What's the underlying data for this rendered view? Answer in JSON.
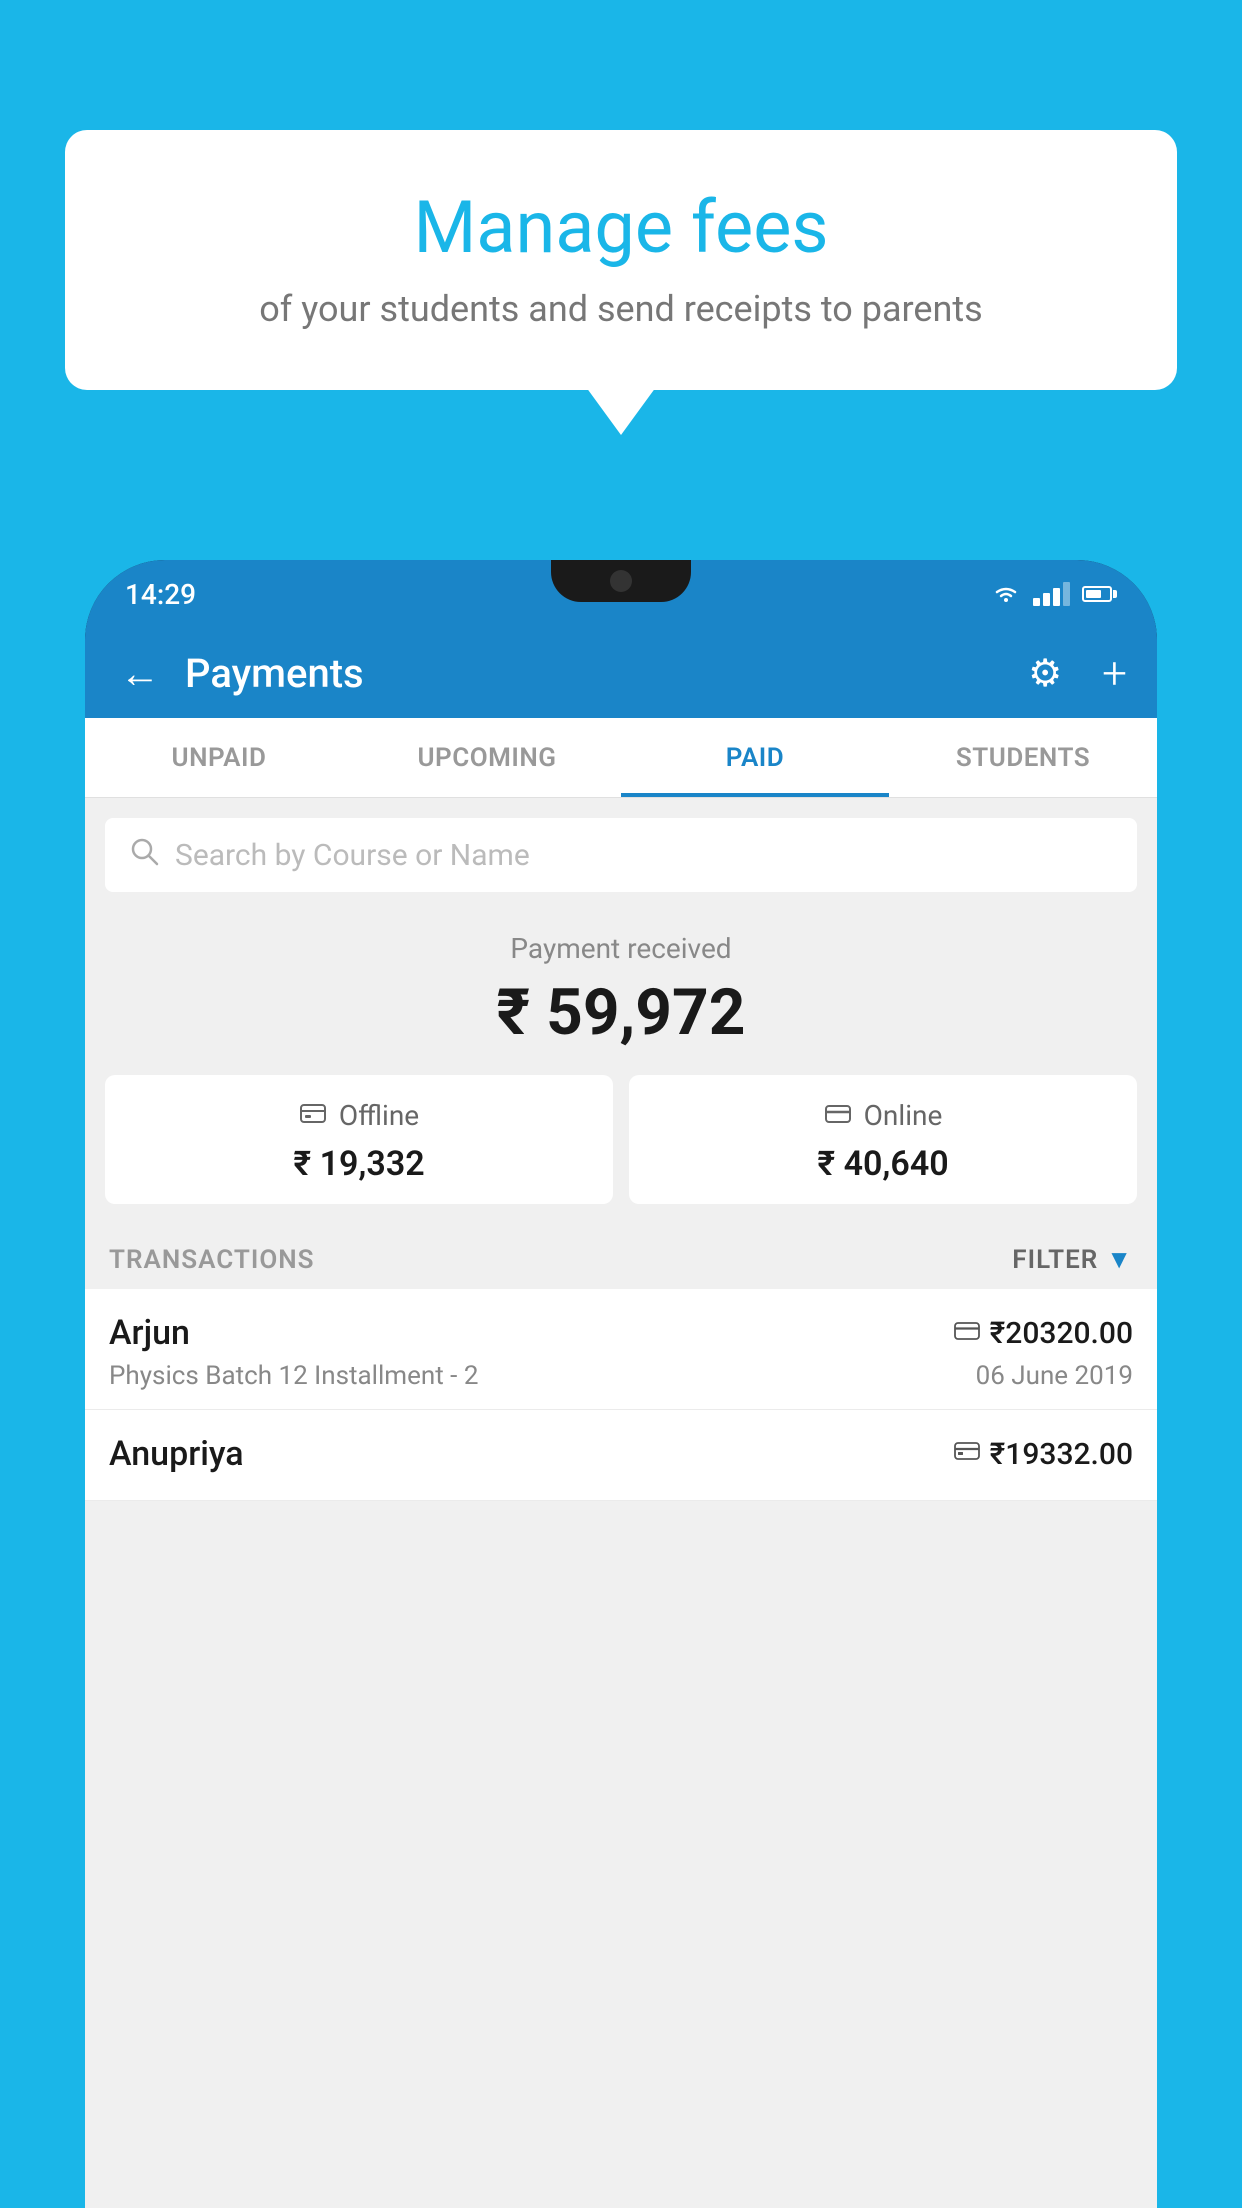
{
  "background_color": "#1ab6e8",
  "speech_bubble": {
    "title": "Manage fees",
    "subtitle": "of your students and send receipts to parents"
  },
  "phone": {
    "status_bar": {
      "time": "14:29"
    },
    "header": {
      "title": "Payments",
      "back_label": "←",
      "gear_label": "⚙",
      "plus_label": "+"
    },
    "tabs": [
      {
        "label": "UNPAID",
        "active": false
      },
      {
        "label": "UPCOMING",
        "active": false
      },
      {
        "label": "PAID",
        "active": true
      },
      {
        "label": "STUDENTS",
        "active": false
      }
    ],
    "search": {
      "placeholder": "Search by Course or Name"
    },
    "payment_summary": {
      "label": "Payment received",
      "total": "₹ 59,972",
      "offline_label": "Offline",
      "offline_amount": "₹ 19,332",
      "online_label": "Online",
      "online_amount": "₹ 40,640"
    },
    "transactions": {
      "section_label": "TRANSACTIONS",
      "filter_label": "FILTER",
      "rows": [
        {
          "name": "Arjun",
          "description": "Physics Batch 12 Installment - 2",
          "amount": "₹20320.00",
          "date": "06 June 2019",
          "payment_type": "online"
        },
        {
          "name": "Anupriya",
          "description": "",
          "amount": "₹19332.00",
          "date": "",
          "payment_type": "offline"
        }
      ]
    }
  }
}
